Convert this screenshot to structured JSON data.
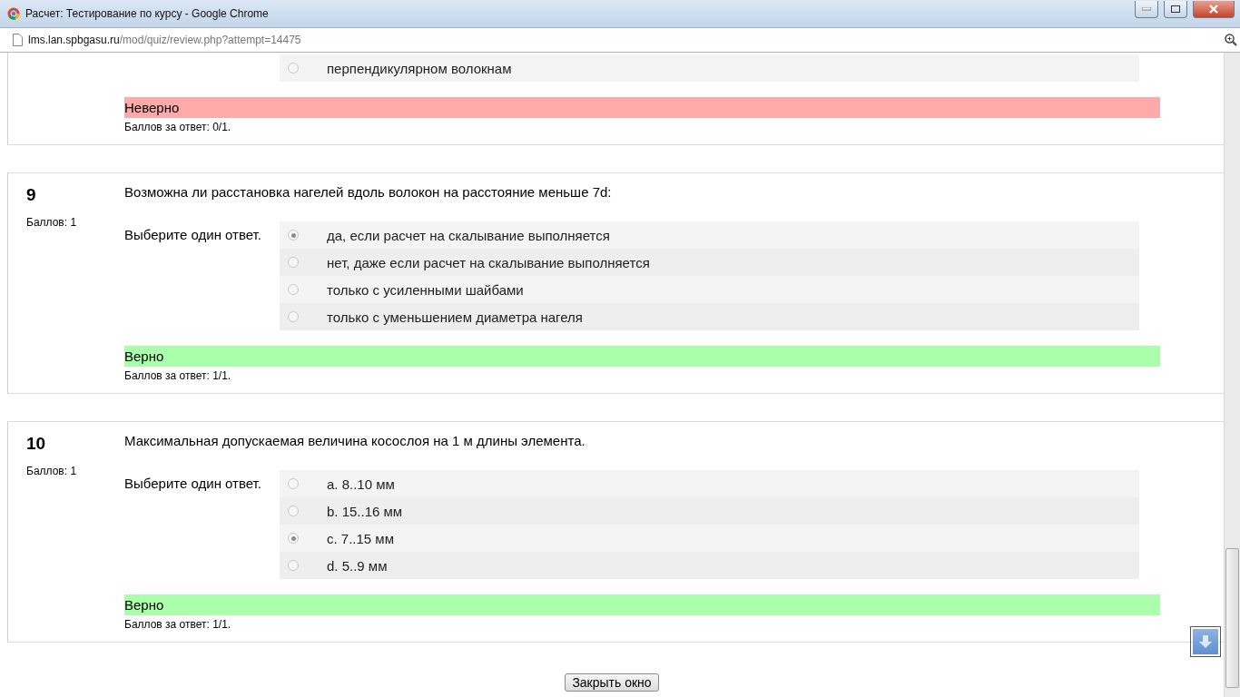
{
  "window": {
    "title": "Расчет: Тестирование по курсу - Google Chrome"
  },
  "address": {
    "host": "lms.lan.spbgasu.ru",
    "path": "/mod/quiz/review.php?attempt=14475"
  },
  "partial_question": {
    "options": [
      {
        "label": "перпендикулярном волокнам",
        "selected": false
      }
    ],
    "feedback": {
      "kind": "incorrect",
      "text": "Неверно"
    },
    "score": "Баллов за ответ: 0/1."
  },
  "questions": [
    {
      "number": "9",
      "marks": "Баллов: 1",
      "text": "Возможна ли расстановка нагелей вдоль волокон на расстояние меньше 7d:",
      "prompt": "Выберите один ответ.",
      "options": [
        {
          "label": "да, если расчет на скалывание выполняется",
          "selected": true
        },
        {
          "label": "нет, даже если расчет на скалывание выполняется",
          "selected": false
        },
        {
          "label": "только с усиленными шайбами",
          "selected": false
        },
        {
          "label": "только с уменьшением диаметра нагеля",
          "selected": false
        }
      ],
      "feedback": {
        "kind": "correct",
        "text": "Верно"
      },
      "score": "Баллов за ответ: 1/1."
    },
    {
      "number": "10",
      "marks": "Баллов: 1",
      "text": "Максимальная допускаемая величина косослоя на 1 м длины элемента.",
      "prompt": "Выберите один ответ.",
      "options": [
        {
          "label": "a. 8..10 мм",
          "selected": false
        },
        {
          "label": "b. 15..16 мм",
          "selected": false
        },
        {
          "label": "c. 7..15 мм",
          "selected": true
        },
        {
          "label": "d. 5..9 мм",
          "selected": false
        }
      ],
      "feedback": {
        "kind": "correct",
        "text": "Верно"
      },
      "score": "Баллов за ответ: 1/1."
    }
  ],
  "close_button": "Закрыть окно"
}
